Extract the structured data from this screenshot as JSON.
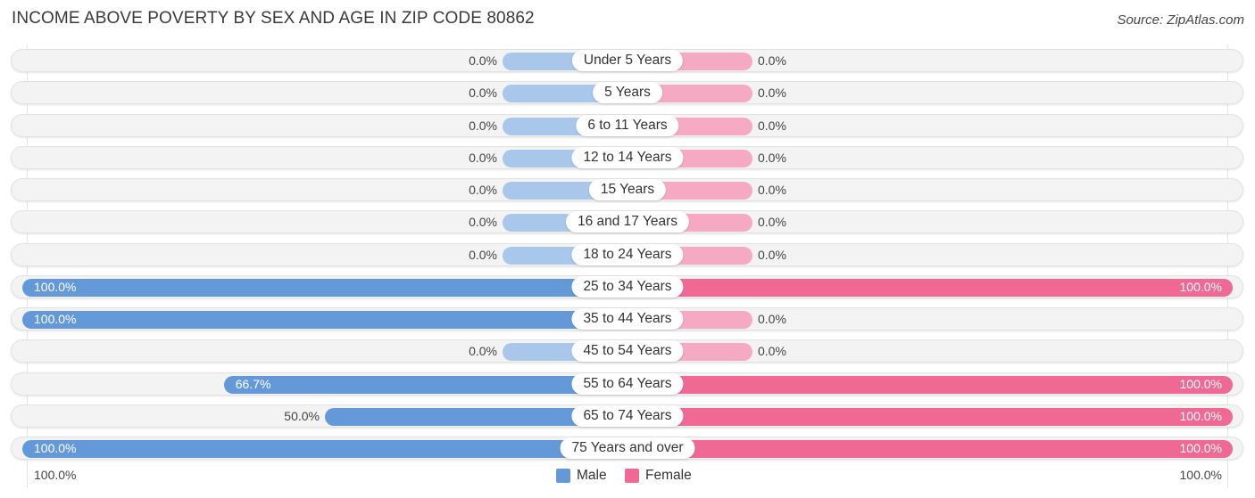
{
  "title": "INCOME ABOVE POVERTY BY SEX AND AGE IN ZIP CODE 80862",
  "source": "Source: ZipAtlas.com",
  "colors": {
    "male": "#6399d9",
    "male_zero": "#a9c7ea",
    "female": "#f06994",
    "female_zero": "#f5a9c2"
  },
  "axis": {
    "left_label": "100.0%",
    "right_label": "100.0%"
  },
  "legend": [
    {
      "label": "Male",
      "color": "#6399d9"
    },
    {
      "label": "Female",
      "color": "#f06994"
    }
  ],
  "chart_data": {
    "type": "bar",
    "orientation": "horizontal-diverging",
    "title": "INCOME ABOVE POVERTY BY SEX AND AGE IN ZIP CODE 80862",
    "xlabel": "",
    "ylabel": "",
    "xlim": [
      -100,
      100
    ],
    "unit": "%",
    "legend_position": "bottom-center",
    "categories": [
      "Under 5 Years",
      "5 Years",
      "6 to 11 Years",
      "12 to 14 Years",
      "15 Years",
      "16 and 17 Years",
      "18 to 24 Years",
      "25 to 34 Years",
      "35 to 44 Years",
      "45 to 54 Years",
      "55 to 64 Years",
      "65 to 74 Years",
      "75 Years and over"
    ],
    "series": [
      {
        "name": "Male",
        "values": [
          0,
          0,
          0,
          0,
          0,
          0,
          0,
          100,
          100,
          0,
          66.7,
          50,
          100
        ],
        "labels": [
          "0.0%",
          "0.0%",
          "0.0%",
          "0.0%",
          "0.0%",
          "0.0%",
          "0.0%",
          "100.0%",
          "100.0%",
          "0.0%",
          "66.7%",
          "50.0%",
          "100.0%"
        ]
      },
      {
        "name": "Female",
        "values": [
          0,
          0,
          0,
          0,
          0,
          0,
          0,
          100,
          0,
          0,
          100,
          100,
          100
        ],
        "labels": [
          "0.0%",
          "0.0%",
          "0.0%",
          "0.0%",
          "0.0%",
          "0.0%",
          "0.0%",
          "100.0%",
          "0.0%",
          "0.0%",
          "100.0%",
          "100.0%",
          "100.0%"
        ]
      }
    ]
  }
}
